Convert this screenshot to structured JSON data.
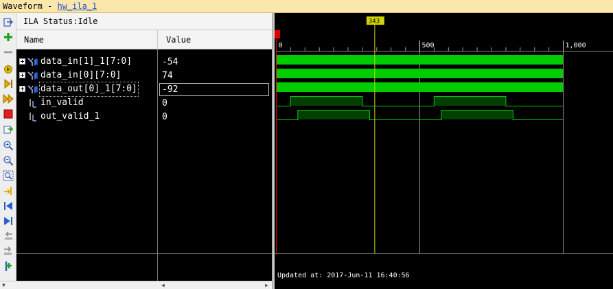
{
  "window": {
    "title_prefix": "Waveform - ",
    "title_link": "hw_ila_1"
  },
  "status": {
    "text": "ILA Status:Idle"
  },
  "columns": {
    "name": "Name",
    "value": "Value"
  },
  "signals": [
    {
      "name": "data_in[1]_1[7:0]",
      "value": "-54",
      "type": "bus"
    },
    {
      "name": "data_in[0][7:0]",
      "value": "74",
      "type": "bus"
    },
    {
      "name": "data_out[0]_1[7:0]",
      "value": "-92",
      "type": "bus",
      "selected": true
    },
    {
      "name": "in_valid",
      "value": "0",
      "type": "bit"
    },
    {
      "name": "out_valid_1",
      "value": "0",
      "type": "bit"
    }
  ],
  "timeline": {
    "min": 0,
    "max": 1000,
    "ticks": [
      {
        "value": 0,
        "label": "0"
      },
      {
        "value": 500,
        "label": "500"
      },
      {
        "value": 1000,
        "label": "1,000"
      }
    ],
    "cursor": {
      "value": 343,
      "label": "343"
    },
    "bus_end": 1000,
    "bit_waves": [
      {
        "signal": "in_valid",
        "pulses": [
          [
            50,
            300
          ],
          [
            550,
            800
          ]
        ],
        "end": 1000
      },
      {
        "signal": "out_valid_1",
        "pulses": [
          [
            75,
            325
          ],
          [
            575,
            825
          ]
        ],
        "end": 1000
      }
    ],
    "updated_text": "Updated at: 2017-Jun-11 16:40:56"
  },
  "colors": {
    "bus_fill": "#00cc00",
    "bit_high_fill": "#003f00",
    "wave_line": "#00cc00",
    "cursor": "#d4d400",
    "gridline": "#8c8c8c",
    "start_marker": "#e00000"
  },
  "toolbar_icons": [
    "fit-to-window-icon",
    "add-probe-icon",
    "remove-icon",
    "run-trigger-icon",
    "run-immediate-icon",
    "auto-retrigger-icon",
    "stop-icon",
    "export-icon",
    "zoom-in-icon",
    "zoom-out-icon",
    "zoom-fit-icon",
    "go-to-cursor-icon",
    "go-to-start-icon",
    "go-to-end-icon",
    "previous-transition-icon",
    "next-transition-icon",
    "add-marker-icon"
  ]
}
